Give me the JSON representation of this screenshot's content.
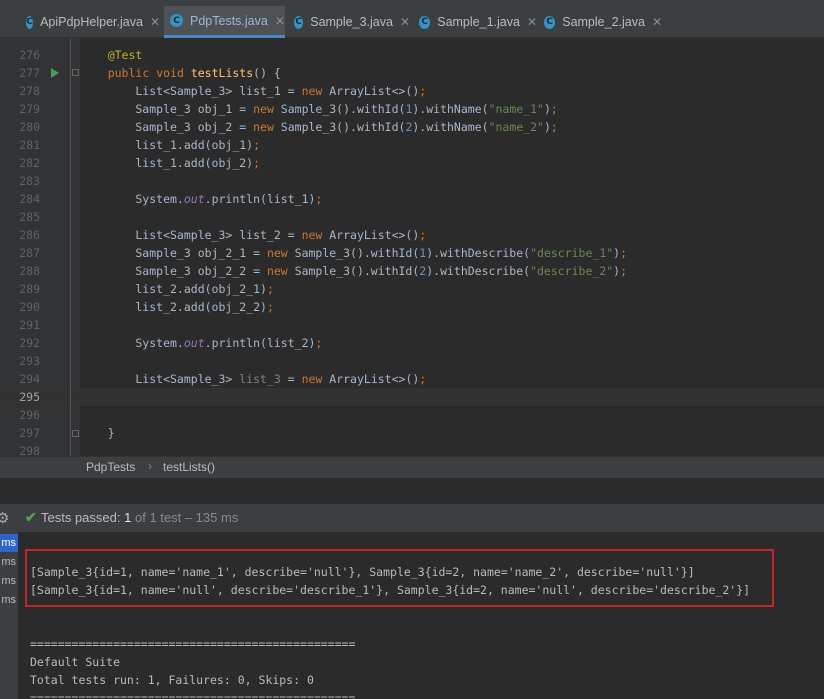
{
  "tabs": [
    {
      "label": "ApiPdpHelper.java",
      "active": false,
      "icon": "class-icon"
    },
    {
      "label": "PdpTests.java",
      "active": true,
      "icon": "class-icon"
    },
    {
      "label": "Sample_3.java",
      "active": false,
      "icon": "class-icon"
    },
    {
      "label": "Sample_1.java",
      "active": false,
      "icon": "class-icon"
    },
    {
      "label": "Sample_2.java",
      "active": false,
      "icon": "class-icon"
    }
  ],
  "editor": {
    "line_numbers": [
      "276",
      "277",
      "278",
      "279",
      "280",
      "281",
      "282",
      "283",
      "284",
      "285",
      "286",
      "287",
      "288",
      "289",
      "290",
      "291",
      "292",
      "293",
      "294",
      "295",
      "296",
      "297",
      "298"
    ],
    "current_line": "295",
    "lines": [
      {
        "text": "    @Test"
      },
      {
        "text": "    public void testLists() {"
      },
      {
        "text": "        List<Sample_3> list_1 = new ArrayList<>();"
      },
      {
        "text": "        Sample_3 obj_1 = new Sample_3().withId(1).withName(\"name_1\");"
      },
      {
        "text": "        Sample_3 obj_2 = new Sample_3().withId(2).withName(\"name_2\");"
      },
      {
        "text": "        list_1.add(obj_1);"
      },
      {
        "text": "        list_1.add(obj_2);"
      },
      {
        "text": ""
      },
      {
        "text": "        System.out.println(list_1);"
      },
      {
        "text": ""
      },
      {
        "text": "        List<Sample_3> list_2 = new ArrayList<>();"
      },
      {
        "text": "        Sample_3 obj_2_1 = new Sample_3().withId(1).withDescribe(\"describe_1\");"
      },
      {
        "text": "        Sample_3 obj_2_2 = new Sample_3().withId(2).withDescribe(\"describe_2\");"
      },
      {
        "text": "        list_2.add(obj_2_1);"
      },
      {
        "text": "        list_2.add(obj_2_2);"
      },
      {
        "text": ""
      },
      {
        "text": "        System.out.println(list_2);"
      },
      {
        "text": ""
      },
      {
        "text": "        List<Sample_3> list_3 = new ArrayList<>();"
      },
      {
        "text": ""
      },
      {
        "text": ""
      },
      {
        "text": "    }"
      },
      {
        "text": ""
      }
    ]
  },
  "breadcrumb": {
    "class_name": "PdpTests",
    "method_name": "testLists()",
    "separator": "›"
  },
  "test_status": {
    "prefix": "Tests passed:",
    "passed": "1",
    "suffix": "of 1 test – 135 ms"
  },
  "side_items": [
    "ms",
    "ms",
    "ms",
    "ms"
  ],
  "console": {
    "highlighted": [
      "[Sample_3{id=1, name='name_1', describe='null'}, Sample_3{id=2, name='name_2', describe='null'}]",
      "[Sample_3{id=1, name='null', describe='describe_1'}, Sample_3{id=2, name='null', describe='describe_2'}]"
    ],
    "separator": "===============================================",
    "suite_name": "Default Suite",
    "summary": "Total tests run: 1, Failures: 0, Skips: 0"
  },
  "colors": {
    "highlight_border": "#c0272d",
    "pass_green": "#5f9e54",
    "active_tab_underline": "#4a88c7"
  }
}
